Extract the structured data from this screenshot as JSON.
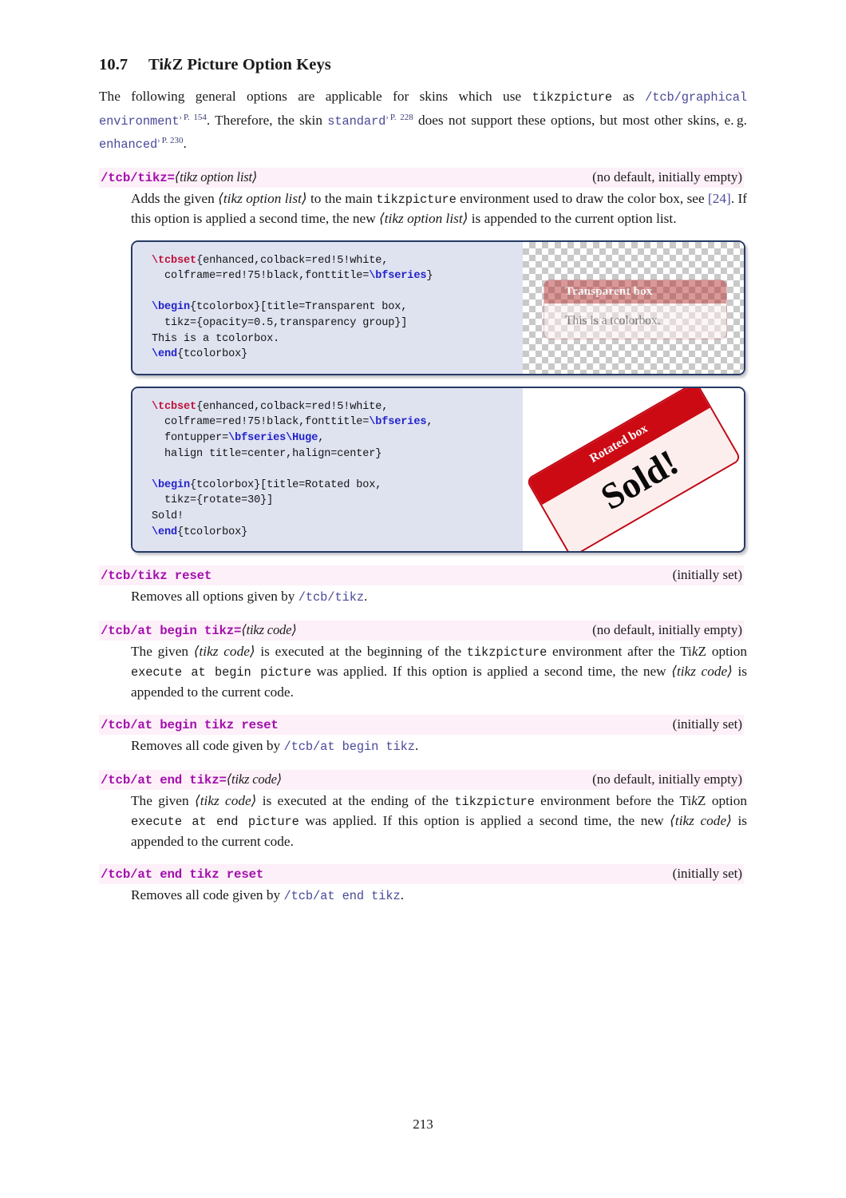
{
  "heading": {
    "number": "10.7",
    "title_pre": "Ti",
    "title_k": "k",
    "title_post": "Z Picture Option Keys"
  },
  "intro": {
    "t1": "The following general options are applicable for skins which use ",
    "code1": "tikzpicture",
    "t2": " as ",
    "link1": "/tcb/graphical environment",
    "ref1": "P. 154",
    "t3": ". Therefore, the skin ",
    "link2": "standard",
    "ref2": "P. 228",
    "t4": " does not support these options, but most other skins, e. g. ",
    "link3": "enhanced",
    "ref3": "P. 230",
    "t5": "."
  },
  "options": [
    {
      "key": "/tcb/tikz=",
      "arg": "⟨tikz option list⟩",
      "default": "(no default, initially empty)",
      "desc_parts": {
        "a": "Adds the given ",
        "arg1": "⟨tikz option list⟩",
        "b": " to the main ",
        "code1": "tikzpicture",
        "c": " environment used to draw the color box, see ",
        "cite": "[24]",
        "d": ". If this option is applied a second time, the new ",
        "arg2": "⟨tikz option list⟩",
        "e": " is appended to the current option list."
      }
    },
    {
      "key": "/tcb/tikz reset",
      "arg": "",
      "default": "(initially set)",
      "desc_parts": {
        "a": "Removes all options given by ",
        "link": "/tcb/tikz",
        "b": "."
      }
    },
    {
      "key": "/tcb/at begin tikz=",
      "arg": "⟨tikz code⟩",
      "default": "(no default, initially empty)",
      "desc_parts": {
        "a": "The given ",
        "arg1": "⟨tikz code⟩",
        "b": " is executed at the beginning of the ",
        "code1": "tikzpicture",
        "c": " environment after the Ti",
        "c_k": "k",
        "c2": "Z option ",
        "code2": "execute at begin picture",
        "d": " was applied. If this option is applied a second time, the new ",
        "arg2": "⟨tikz code⟩",
        "e": " is appended to the current code."
      }
    },
    {
      "key": "/tcb/at begin tikz reset",
      "arg": "",
      "default": "(initially set)",
      "desc_parts": {
        "a": "Removes all code given by ",
        "link": "/tcb/at begin tikz",
        "b": "."
      }
    },
    {
      "key": "/tcb/at end tikz=",
      "arg": "⟨tikz code⟩",
      "default": "(no default, initially empty)",
      "desc_parts": {
        "a": "The given ",
        "arg1": "⟨tikz code⟩",
        "b": " is executed at the ending of the ",
        "code1": "tikzpicture",
        "c": " environment before the Ti",
        "c_k": "k",
        "c2": "Z option ",
        "code2": "execute at end picture",
        "d": " was applied. If this option is applied a second time, the new ",
        "arg2": "⟨tikz code⟩",
        "e": " is appended to the current code."
      }
    },
    {
      "key": "/tcb/at end tikz reset",
      "arg": "",
      "default": "(initially set)",
      "desc_parts": {
        "a": "Removes all code given by ",
        "link": "/tcb/at end tikz",
        "b": "."
      }
    }
  ],
  "examples": [
    {
      "code_lines": [
        {
          "cmd": "\\tcbset",
          "cmd_color": "red",
          "rest": "{enhanced,colback=red!5!white,"
        },
        {
          "cmd": "",
          "rest": "  colframe=red!75!black,fonttitle=",
          "cmd2": "\\bfseries",
          "cmd2_color": "blue",
          "rest2": "}"
        },
        {
          "cmd": "",
          "rest": ""
        },
        {
          "cmd": "\\begin",
          "cmd_color": "blue",
          "rest": "{tcolorbox}[title=Transparent box,"
        },
        {
          "cmd": "",
          "rest": "  tikz={opacity=0.5,transparency group}]"
        },
        {
          "cmd": "",
          "rest": "This is a tcolorbox."
        },
        {
          "cmd": "\\end",
          "cmd_color": "blue",
          "rest": "{tcolorbox}"
        }
      ],
      "result": {
        "type": "transparent-box",
        "title": "Transparent box",
        "body": "This is a tcolorbox."
      }
    },
    {
      "code_lines": [
        {
          "cmd": "\\tcbset",
          "cmd_color": "red",
          "rest": "{enhanced,colback=red!5!white,"
        },
        {
          "cmd": "",
          "rest": "  colframe=red!75!black,fonttitle=",
          "cmd2": "\\bfseries",
          "cmd2_color": "blue",
          "rest2": ","
        },
        {
          "cmd": "",
          "rest": "  fontupper=",
          "cmd2": "\\bfseries\\Huge",
          "cmd2_color": "blue",
          "rest2": ","
        },
        {
          "cmd": "",
          "rest": "  halign title=center,halign=center}"
        },
        {
          "cmd": "",
          "rest": ""
        },
        {
          "cmd": "\\begin",
          "cmd_color": "blue",
          "rest": "{tcolorbox}[title=Rotated box,"
        },
        {
          "cmd": "",
          "rest": "  tikz={rotate=30}]"
        },
        {
          "cmd": "",
          "rest": "Sold!"
        },
        {
          "cmd": "\\end",
          "cmd_color": "blue",
          "rest": "{tcolorbox}"
        }
      ],
      "result": {
        "type": "rotated-box",
        "title": "Rotated box",
        "body": "Sold!",
        "rotation": "-30"
      }
    }
  ],
  "page_number": "213",
  "colors": {
    "option_key": "#a30fae",
    "option_row_bg": "#fdf0f8",
    "link": "#4a4a9a",
    "code_box_bg": "#dfe3f0",
    "code_box_border": "#253a66",
    "latex_cmd_red": "#c0113c",
    "latex_cmd_blue": "#2222cc",
    "tcolorbox_frame": "#cc0a14",
    "tcolorbox_back": "#fdeeee"
  }
}
